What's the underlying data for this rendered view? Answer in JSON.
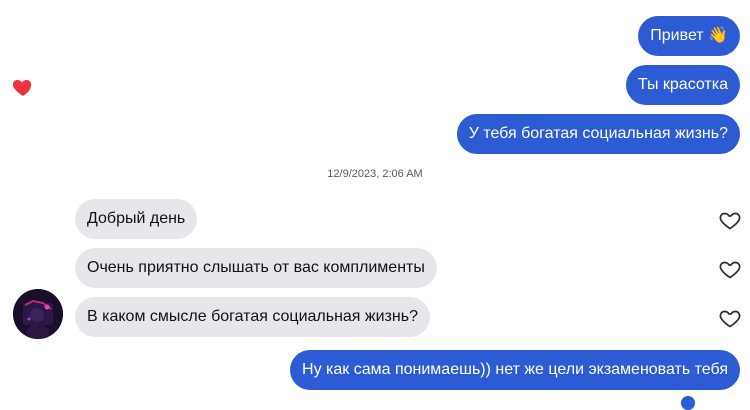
{
  "messages_top": [
    {
      "text": "Привет 👋"
    },
    {
      "text": "Ты красотка"
    },
    {
      "text": "У тебя богатая социальная жизнь?"
    }
  ],
  "timestamp": "12/9/2023, 2:06 AM",
  "messages_incoming": [
    {
      "text": "Добрый день"
    },
    {
      "text": "Очень приятно слышать от вас комплименты"
    },
    {
      "text": "В каком смысле богатая социальная жизнь?"
    }
  ],
  "messages_bottom": [
    {
      "text": "Ну как сама понимаешь)) нет же цели экзаменовать тебя"
    }
  ],
  "colors": {
    "outgoing_bubble": "#2d5bd3",
    "incoming_bubble": "#e6e7ea",
    "reaction_heart": "#f0313e"
  },
  "icons": {
    "reaction": "heart-filled-icon",
    "like": "heart-outline-icon"
  }
}
